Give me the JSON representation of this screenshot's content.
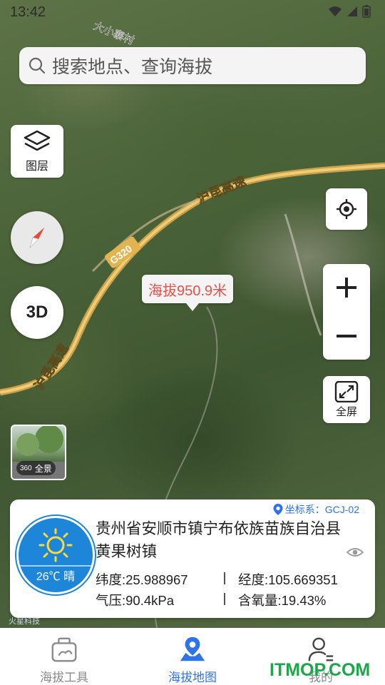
{
  "status_bar": {
    "time": "13:42"
  },
  "search": {
    "placeholder": "搜索地点、查询海拔"
  },
  "map": {
    "roads": {
      "expressway_label": "沪昆高速",
      "expressway_label_lower": "沪昆高速",
      "national_road": "G320",
      "village_label": "大小寨村"
    },
    "layers_label": "图层",
    "three_d_label": "3D",
    "altitude_label": "海拔950.9米",
    "fullscreen_label": "全屏",
    "panorama": {
      "badge_number": "360",
      "badge_label": "全景"
    }
  },
  "location_card": {
    "coord_system": "坐标系：GCJ-02",
    "weather": {
      "temperature": "26℃",
      "condition": "晴"
    },
    "address": "贵州省安顺市镇宁布依族苗族自治县黄果树镇",
    "latitude": "纬度:25.988967",
    "longitude": "经度:105.669351",
    "pressure": "气压:90.4kPa",
    "oxygen": "含氧量:19.43%"
  },
  "watermark": "火星科技",
  "tabs": [
    {
      "label": "海拔工具",
      "active": false
    },
    {
      "label": "海拔地图",
      "active": true
    },
    {
      "label": "我的",
      "active": false
    }
  ],
  "site_watermark": "ITMOP.COM",
  "colors": {
    "accent": "#2f73e8",
    "altitude_text": "#e5524a",
    "weather_bg": "#1e86d8",
    "inactive_tab": "#8a8a8a"
  }
}
